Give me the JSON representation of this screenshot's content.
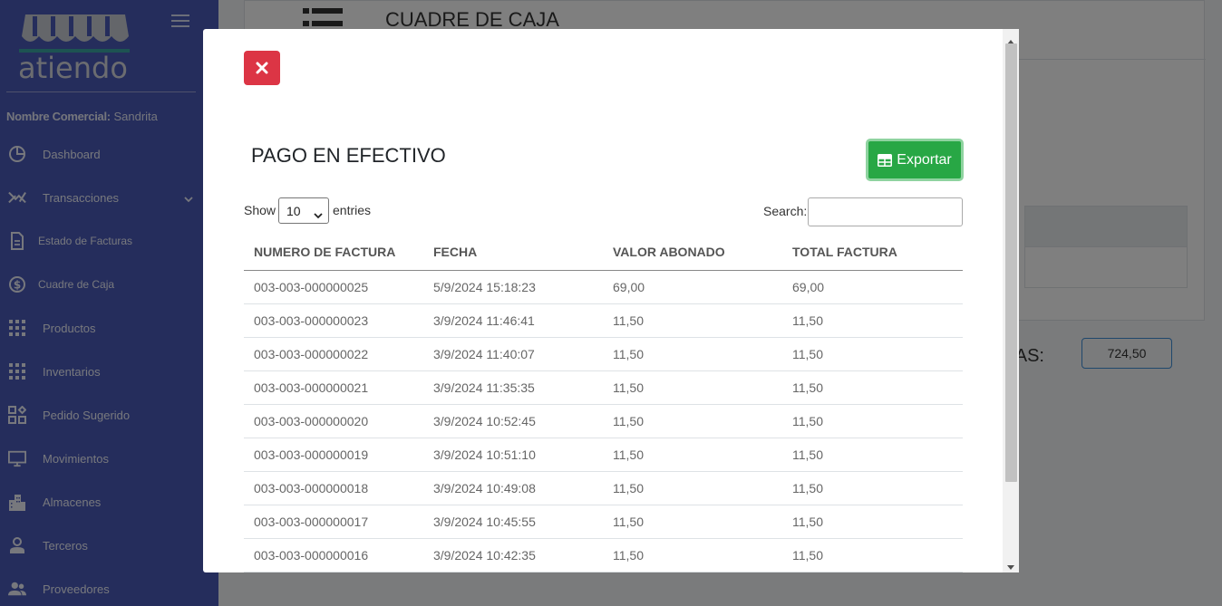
{
  "sidebar": {
    "logo_text": "atiendo",
    "merchant_label": "Nombre Comercial:",
    "merchant_name": "Sandrita",
    "items": [
      {
        "label": "Dashboard",
        "icon": "pie-chart-icon"
      },
      {
        "label": "Transacciones",
        "icon": "transactions-icon"
      },
      {
        "label": "Estado de Facturas",
        "icon": "document-icon"
      },
      {
        "label": "Cuadre de Caja",
        "icon": "dollar-circle-icon"
      },
      {
        "label": "Productos",
        "icon": "grid-icon"
      },
      {
        "label": "Inventarios",
        "icon": "grid-icon"
      },
      {
        "label": "Pedido Sugerido",
        "icon": "widgets-icon"
      },
      {
        "label": "Movimientos",
        "icon": "monitor-icon"
      },
      {
        "label": "Almacenes",
        "icon": "building-icon"
      },
      {
        "label": "Terceros",
        "icon": "person-icon"
      },
      {
        "label": "Proveedores",
        "icon": "people-icon"
      }
    ]
  },
  "background": {
    "page_title": "CUADRE DE CAJA",
    "total_label": "TAS:",
    "total_value": "724,50"
  },
  "modal": {
    "title": "PAGO EN EFECTIVO",
    "export_label": "Exportar",
    "show_label": "Show",
    "entries_value": "10",
    "entries_label": "entries",
    "search_label": "Search:",
    "search_value": "",
    "columns": [
      "NUMERO DE FACTURA",
      "FECHA",
      "VALOR ABONADO",
      "TOTAL FACTURA"
    ],
    "rows": [
      [
        "003-003-000000025",
        "5/9/2024 15:18:23",
        "69,00",
        "69,00"
      ],
      [
        "003-003-000000023",
        "3/9/2024 11:46:41",
        "11,50",
        "11,50"
      ],
      [
        "003-003-000000022",
        "3/9/2024 11:40:07",
        "11,50",
        "11,50"
      ],
      [
        "003-003-000000021",
        "3/9/2024 11:35:35",
        "11,50",
        "11,50"
      ],
      [
        "003-003-000000020",
        "3/9/2024 10:52:45",
        "11,50",
        "11,50"
      ],
      [
        "003-003-000000019",
        "3/9/2024 10:51:10",
        "11,50",
        "11,50"
      ],
      [
        "003-003-000000018",
        "3/9/2024 10:49:08",
        "11,50",
        "11,50"
      ],
      [
        "003-003-000000017",
        "3/9/2024 10:45:55",
        "11,50",
        "11,50"
      ],
      [
        "003-003-000000016",
        "3/9/2024 10:42:35",
        "11,50",
        "11,50"
      ]
    ]
  },
  "colors": {
    "sidebar": "#4b5bb8",
    "close_button": "#dc3545",
    "export_button": "#28a745"
  }
}
